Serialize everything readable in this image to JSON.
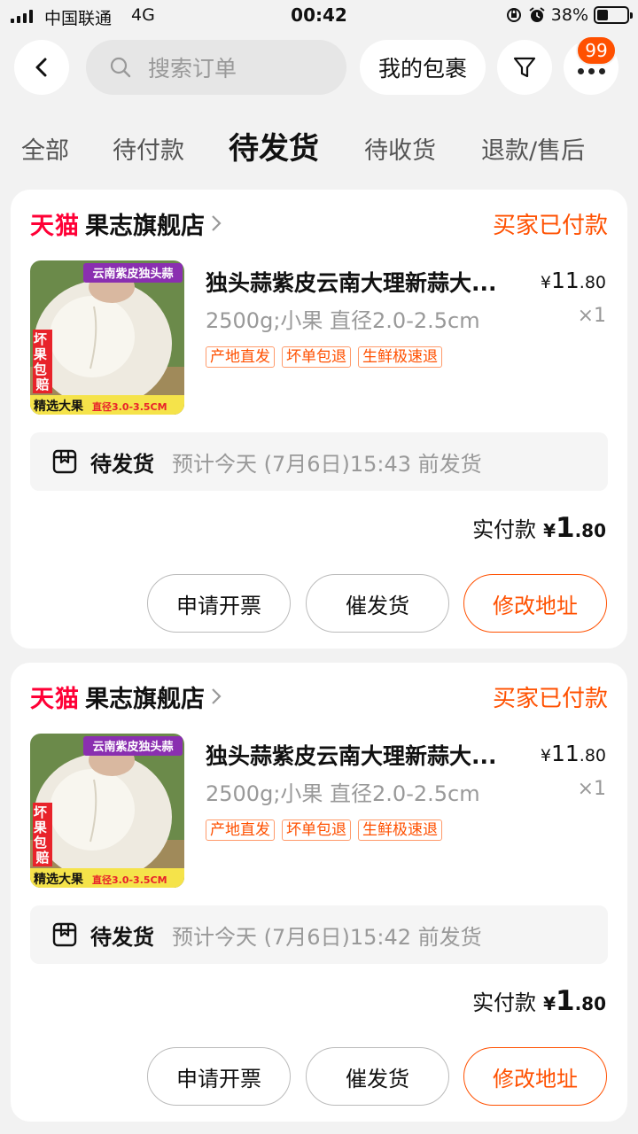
{
  "status_bar": {
    "carrier": "中国联通",
    "network": "4G",
    "time": "00:42",
    "battery": "38%",
    "battery_level": 0.38
  },
  "header": {
    "search_placeholder": "搜索订单",
    "packages_label": "我的包裹",
    "message_count": "99"
  },
  "tabs": [
    {
      "label": "全部"
    },
    {
      "label": "待付款"
    },
    {
      "label": "待发货",
      "active": true
    },
    {
      "label": "待收货"
    },
    {
      "label": "退款/售后"
    }
  ],
  "orders": [
    {
      "tmall": "天猫",
      "store": "果志旗舰店",
      "status": "买家已付款",
      "product_title": "独头蒜紫皮云南大理新蒜大...",
      "price_currency": "¥",
      "price_int": "11",
      "price_dec": ".80",
      "sku": "2500g;小果 直径2.0-2.5cm",
      "qty": "×1",
      "tags": [
        "产地直发",
        "坏单包退",
        "生鲜极速退"
      ],
      "image_text": {
        "top": "云南紫皮独头蒜",
        "left": "坏果包赔",
        "bottom": "精选大果",
        "size": "直径3.0-3.5CM"
      },
      "ship_label": "待发货",
      "ship_eta": "预计今天 (7月6日)15:43 前发货",
      "paid_label": "实付款",
      "paid_currency": "¥",
      "paid_int": "1",
      "paid_dec": ".80",
      "buttons": {
        "invoice": "申请开票",
        "urge": "催发货",
        "address": "修改地址"
      }
    },
    {
      "tmall": "天猫",
      "store": "果志旗舰店",
      "status": "买家已付款",
      "product_title": "独头蒜紫皮云南大理新蒜大...",
      "price_currency": "¥",
      "price_int": "11",
      "price_dec": ".80",
      "sku": "2500g;小果 直径2.0-2.5cm",
      "qty": "×1",
      "tags": [
        "产地直发",
        "坏单包退",
        "生鲜极速退"
      ],
      "image_text": {
        "top": "云南紫皮独头蒜",
        "left": "坏果包赔",
        "bottom": "精选大果",
        "size": "直径3.0-3.5CM"
      },
      "ship_label": "待发货",
      "ship_eta": "预计今天 (7月6日)15:42 前发货",
      "paid_label": "实付款",
      "paid_currency": "¥",
      "paid_int": "1",
      "paid_dec": ".80",
      "buttons": {
        "invoice": "申请开票",
        "urge": "催发货",
        "address": "修改地址"
      }
    }
  ],
  "colors": {
    "accent": "#ff5000",
    "tmall_red": "#ff0036",
    "background": "#f2f2f2"
  },
  "icons": [
    "back-arrow-icon",
    "search-icon",
    "filter-icon",
    "more-icon",
    "chevron-right-icon",
    "package-box-icon"
  ]
}
